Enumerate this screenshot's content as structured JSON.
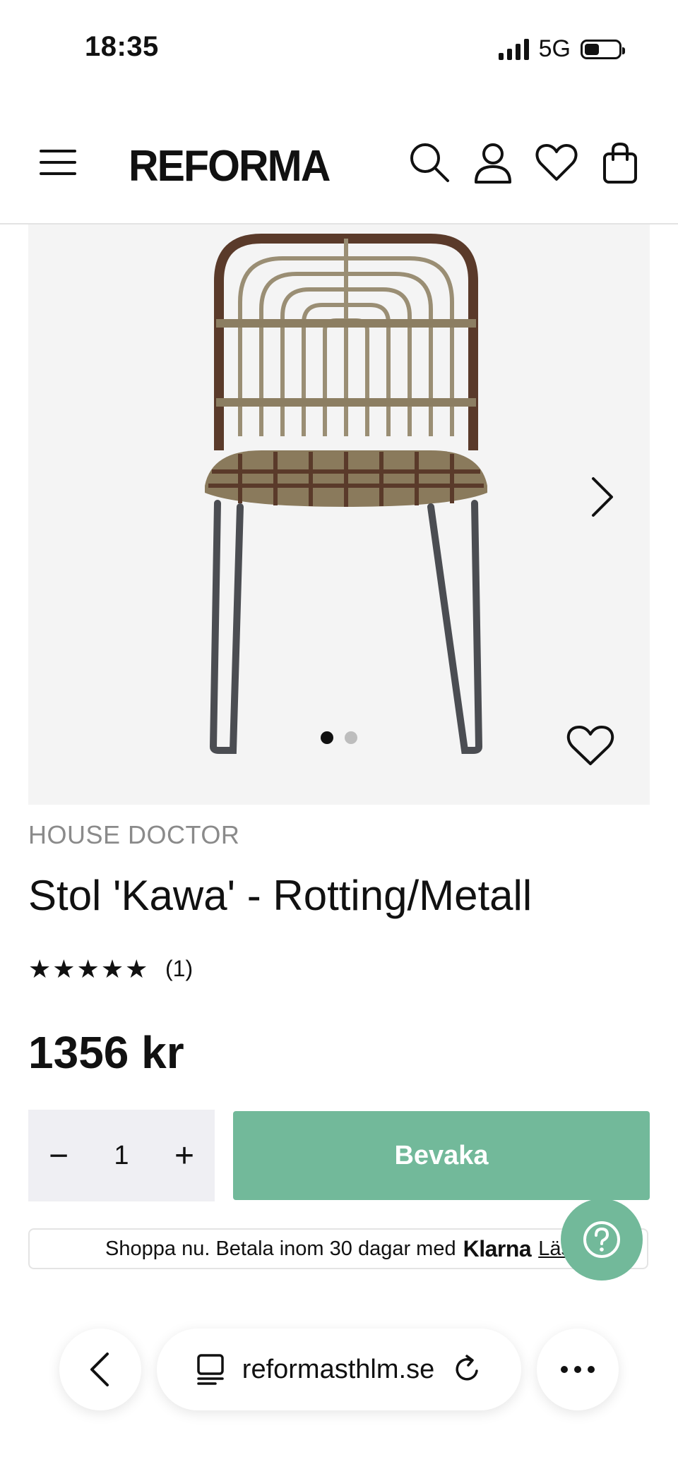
{
  "status_bar": {
    "time": "18:35",
    "network": "5G"
  },
  "header": {
    "logo": "REFORMA"
  },
  "product": {
    "brand": "HOUSE DOCTOR",
    "title": "Stol 'Kawa' - Rotting/Metall",
    "stars": "★★★★★",
    "rating": 5,
    "review_count": "(1)",
    "price": "1356 kr",
    "gallery": {
      "total_images": 2,
      "current_index": 1
    }
  },
  "purchase": {
    "qty_minus": "−",
    "quantity": "1",
    "qty_plus": "+",
    "watch_label": "Bevaka"
  },
  "klarna": {
    "text": "Shoppa nu. Betala inom 30 dagar med",
    "logo": "Klarna",
    "link": "Läs"
  },
  "browser": {
    "url": "reformasthlm.se"
  },
  "colors": {
    "accent": "#72b99a",
    "brand_gray": "#8a8a8a",
    "image_bg": "#f4f4f4"
  },
  "icons": [
    "menu-icon",
    "search-icon",
    "user-icon",
    "heart-icon",
    "cart-icon",
    "chevron-right-icon",
    "wishlist-heart-icon",
    "help-icon",
    "back-icon",
    "tabs-icon",
    "reload-icon",
    "more-icon"
  ]
}
